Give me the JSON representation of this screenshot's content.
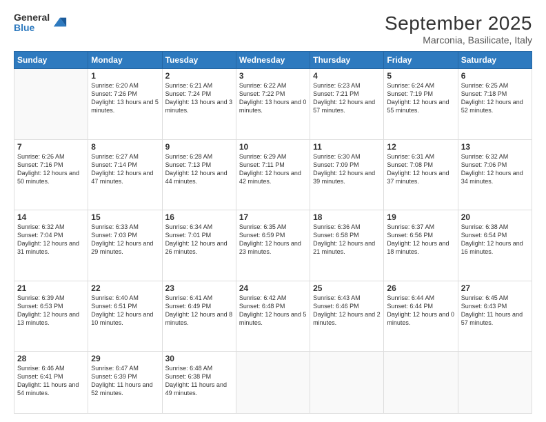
{
  "header": {
    "logo_line1": "General",
    "logo_line2": "Blue",
    "title": "September 2025",
    "subtitle": "Marconia, Basilicate, Italy"
  },
  "weekdays": [
    "Sunday",
    "Monday",
    "Tuesday",
    "Wednesday",
    "Thursday",
    "Friday",
    "Saturday"
  ],
  "weeks": [
    [
      {
        "day": "",
        "sunrise": "",
        "sunset": "",
        "daylight": ""
      },
      {
        "day": "1",
        "sunrise": "Sunrise: 6:20 AM",
        "sunset": "Sunset: 7:26 PM",
        "daylight": "Daylight: 13 hours and 5 minutes."
      },
      {
        "day": "2",
        "sunrise": "Sunrise: 6:21 AM",
        "sunset": "Sunset: 7:24 PM",
        "daylight": "Daylight: 13 hours and 3 minutes."
      },
      {
        "day": "3",
        "sunrise": "Sunrise: 6:22 AM",
        "sunset": "Sunset: 7:22 PM",
        "daylight": "Daylight: 13 hours and 0 minutes."
      },
      {
        "day": "4",
        "sunrise": "Sunrise: 6:23 AM",
        "sunset": "Sunset: 7:21 PM",
        "daylight": "Daylight: 12 hours and 57 minutes."
      },
      {
        "day": "5",
        "sunrise": "Sunrise: 6:24 AM",
        "sunset": "Sunset: 7:19 PM",
        "daylight": "Daylight: 12 hours and 55 minutes."
      },
      {
        "day": "6",
        "sunrise": "Sunrise: 6:25 AM",
        "sunset": "Sunset: 7:18 PM",
        "daylight": "Daylight: 12 hours and 52 minutes."
      }
    ],
    [
      {
        "day": "7",
        "sunrise": "Sunrise: 6:26 AM",
        "sunset": "Sunset: 7:16 PM",
        "daylight": "Daylight: 12 hours and 50 minutes."
      },
      {
        "day": "8",
        "sunrise": "Sunrise: 6:27 AM",
        "sunset": "Sunset: 7:14 PM",
        "daylight": "Daylight: 12 hours and 47 minutes."
      },
      {
        "day": "9",
        "sunrise": "Sunrise: 6:28 AM",
        "sunset": "Sunset: 7:13 PM",
        "daylight": "Daylight: 12 hours and 44 minutes."
      },
      {
        "day": "10",
        "sunrise": "Sunrise: 6:29 AM",
        "sunset": "Sunset: 7:11 PM",
        "daylight": "Daylight: 12 hours and 42 minutes."
      },
      {
        "day": "11",
        "sunrise": "Sunrise: 6:30 AM",
        "sunset": "Sunset: 7:09 PM",
        "daylight": "Daylight: 12 hours and 39 minutes."
      },
      {
        "day": "12",
        "sunrise": "Sunrise: 6:31 AM",
        "sunset": "Sunset: 7:08 PM",
        "daylight": "Daylight: 12 hours and 37 minutes."
      },
      {
        "day": "13",
        "sunrise": "Sunrise: 6:32 AM",
        "sunset": "Sunset: 7:06 PM",
        "daylight": "Daylight: 12 hours and 34 minutes."
      }
    ],
    [
      {
        "day": "14",
        "sunrise": "Sunrise: 6:32 AM",
        "sunset": "Sunset: 7:04 PM",
        "daylight": "Daylight: 12 hours and 31 minutes."
      },
      {
        "day": "15",
        "sunrise": "Sunrise: 6:33 AM",
        "sunset": "Sunset: 7:03 PM",
        "daylight": "Daylight: 12 hours and 29 minutes."
      },
      {
        "day": "16",
        "sunrise": "Sunrise: 6:34 AM",
        "sunset": "Sunset: 7:01 PM",
        "daylight": "Daylight: 12 hours and 26 minutes."
      },
      {
        "day": "17",
        "sunrise": "Sunrise: 6:35 AM",
        "sunset": "Sunset: 6:59 PM",
        "daylight": "Daylight: 12 hours and 23 minutes."
      },
      {
        "day": "18",
        "sunrise": "Sunrise: 6:36 AM",
        "sunset": "Sunset: 6:58 PM",
        "daylight": "Daylight: 12 hours and 21 minutes."
      },
      {
        "day": "19",
        "sunrise": "Sunrise: 6:37 AM",
        "sunset": "Sunset: 6:56 PM",
        "daylight": "Daylight: 12 hours and 18 minutes."
      },
      {
        "day": "20",
        "sunrise": "Sunrise: 6:38 AM",
        "sunset": "Sunset: 6:54 PM",
        "daylight": "Daylight: 12 hours and 16 minutes."
      }
    ],
    [
      {
        "day": "21",
        "sunrise": "Sunrise: 6:39 AM",
        "sunset": "Sunset: 6:53 PM",
        "daylight": "Daylight: 12 hours and 13 minutes."
      },
      {
        "day": "22",
        "sunrise": "Sunrise: 6:40 AM",
        "sunset": "Sunset: 6:51 PM",
        "daylight": "Daylight: 12 hours and 10 minutes."
      },
      {
        "day": "23",
        "sunrise": "Sunrise: 6:41 AM",
        "sunset": "Sunset: 6:49 PM",
        "daylight": "Daylight: 12 hours and 8 minutes."
      },
      {
        "day": "24",
        "sunrise": "Sunrise: 6:42 AM",
        "sunset": "Sunset: 6:48 PM",
        "daylight": "Daylight: 12 hours and 5 minutes."
      },
      {
        "day": "25",
        "sunrise": "Sunrise: 6:43 AM",
        "sunset": "Sunset: 6:46 PM",
        "daylight": "Daylight: 12 hours and 2 minutes."
      },
      {
        "day": "26",
        "sunrise": "Sunrise: 6:44 AM",
        "sunset": "Sunset: 6:44 PM",
        "daylight": "Daylight: 12 hours and 0 minutes."
      },
      {
        "day": "27",
        "sunrise": "Sunrise: 6:45 AM",
        "sunset": "Sunset: 6:43 PM",
        "daylight": "Daylight: 11 hours and 57 minutes."
      }
    ],
    [
      {
        "day": "28",
        "sunrise": "Sunrise: 6:46 AM",
        "sunset": "Sunset: 6:41 PM",
        "daylight": "Daylight: 11 hours and 54 minutes."
      },
      {
        "day": "29",
        "sunrise": "Sunrise: 6:47 AM",
        "sunset": "Sunset: 6:39 PM",
        "daylight": "Daylight: 11 hours and 52 minutes."
      },
      {
        "day": "30",
        "sunrise": "Sunrise: 6:48 AM",
        "sunset": "Sunset: 6:38 PM",
        "daylight": "Daylight: 11 hours and 49 minutes."
      },
      {
        "day": "",
        "sunrise": "",
        "sunset": "",
        "daylight": ""
      },
      {
        "day": "",
        "sunrise": "",
        "sunset": "",
        "daylight": ""
      },
      {
        "day": "",
        "sunrise": "",
        "sunset": "",
        "daylight": ""
      },
      {
        "day": "",
        "sunrise": "",
        "sunset": "",
        "daylight": ""
      }
    ]
  ]
}
